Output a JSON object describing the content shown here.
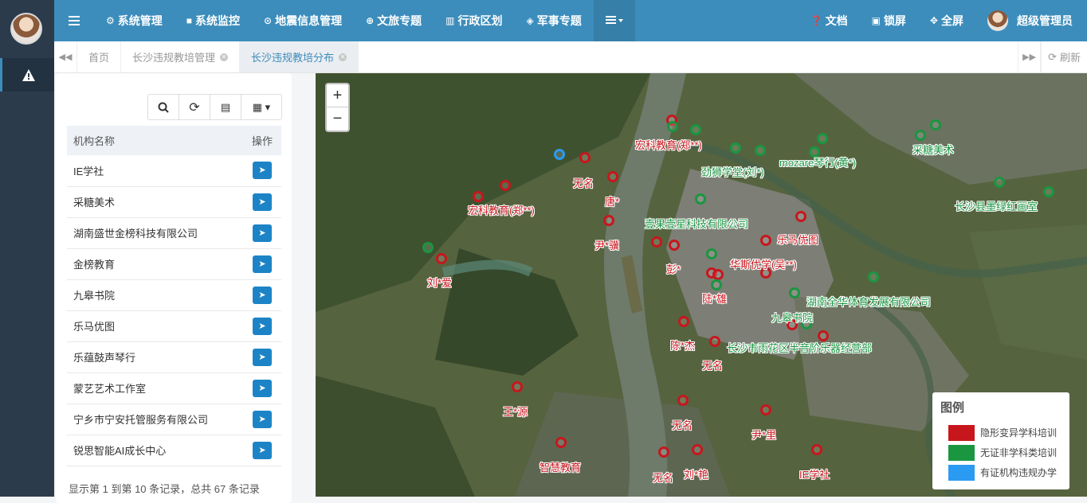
{
  "nav": {
    "items": [
      {
        "label": "",
        "icon": "menu-icon"
      },
      {
        "label": "系统管理",
        "icon": "gear-icon"
      },
      {
        "label": "系统监控",
        "icon": "video-icon"
      },
      {
        "label": "地震信息管理",
        "icon": "map-pin-icon"
      },
      {
        "label": "文旅专题",
        "icon": "globe-icon"
      },
      {
        "label": "行政区划",
        "icon": "building-icon"
      },
      {
        "label": "军事专题",
        "icon": "shield-icon"
      }
    ],
    "more_icon": "list-dropdown-icon",
    "right": {
      "docs": "文档",
      "lock": "锁屏",
      "fullscreen": "全屏",
      "user": "超级管理员"
    }
  },
  "tabs": {
    "items": [
      {
        "label": "首页"
      },
      {
        "label": "长沙违规教培管理"
      },
      {
        "label": "长沙违规教培分布"
      }
    ],
    "refresh": "刷新"
  },
  "list": {
    "columns": {
      "name": "机构名称",
      "action": "操作"
    },
    "rows": [
      {
        "name": "IE学社"
      },
      {
        "name": "采糖美术"
      },
      {
        "name": "湖南盛世金榜科技有限公司"
      },
      {
        "name": "金榜教育"
      },
      {
        "name": "九皋书院"
      },
      {
        "name": "乐马优图"
      },
      {
        "name": "乐蕴鼓声琴行"
      },
      {
        "name": "蒙艺艺术工作室"
      },
      {
        "name": "宁乡市宁安托管服务有限公司"
      },
      {
        "name": "锐思智能AI成长中心"
      }
    ],
    "footer": "显示第 1 到第 10 条记录，总共 67 条记录"
  },
  "map": {
    "zoom_in": "+",
    "zoom_out": "−",
    "legend": {
      "title": "图例",
      "items": [
        {
          "label": "隐形变异学科培训",
          "color": "#c8161d"
        },
        {
          "label": "无证非学科类培训",
          "color": "#1a9641"
        },
        {
          "label": "有证机构违规办学",
          "color": "#2b9af3"
        }
      ]
    },
    "labels": [
      {
        "text": "宏科教育(郑**)",
        "color": "red"
      },
      {
        "text": "无名",
        "color": "red"
      },
      {
        "text": "唐*",
        "color": "red"
      },
      {
        "text": "宏科教育(郑**)",
        "color": "red"
      },
      {
        "text": "尹*骥",
        "color": "red"
      },
      {
        "text": "刘*爱",
        "color": "red"
      },
      {
        "text": "彭*",
        "color": "red"
      },
      {
        "text": "华斯优学(吴**)",
        "color": "red"
      },
      {
        "text": "乐马优图",
        "color": "red"
      },
      {
        "text": "陆*雄",
        "color": "red"
      },
      {
        "text": "陈*杰",
        "color": "red"
      },
      {
        "text": "无名",
        "color": "red"
      },
      {
        "text": "王*源",
        "color": "red"
      },
      {
        "text": "无名",
        "color": "red"
      },
      {
        "text": "尹*里",
        "color": "red"
      },
      {
        "text": "智慧教育",
        "color": "red"
      },
      {
        "text": "无名",
        "color": "red"
      },
      {
        "text": "刘*艳",
        "color": "red"
      },
      {
        "text": "IE学社",
        "color": "red"
      },
      {
        "text": "劲狮学堂(刘*)",
        "color": "green"
      },
      {
        "text": "mozare琴行(黄*)",
        "color": "green"
      },
      {
        "text": "采糖美术",
        "color": "green"
      },
      {
        "text": "长沙县墨绿红画室",
        "color": "green"
      },
      {
        "text": "壹果壹星科技有限公司",
        "color": "green"
      },
      {
        "text": "湖南全华体育发展有限公司",
        "color": "green"
      },
      {
        "text": "九皋书院",
        "color": "green"
      },
      {
        "text": "长沙市雨花区半音阶乐器经营部",
        "color": "green"
      }
    ]
  }
}
